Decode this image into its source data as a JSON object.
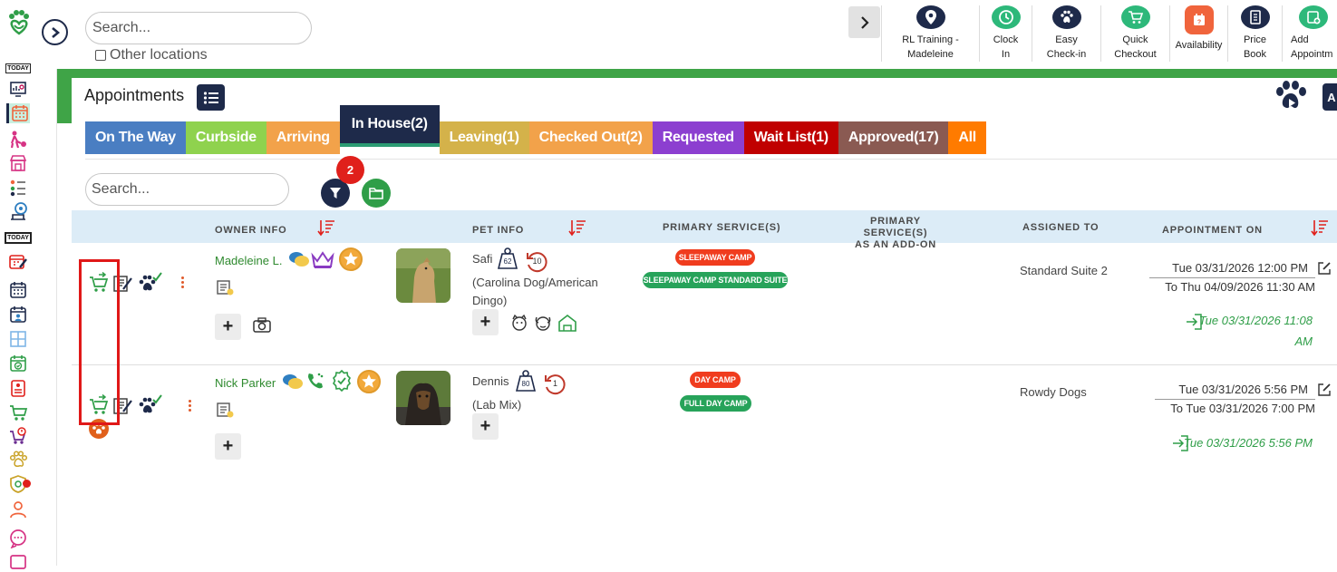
{
  "header": {
    "search_placeholder": "Search...",
    "other_locations_label": "Other locations"
  },
  "toolbar": [
    {
      "label": "RL Training -\nMadeleine",
      "icon": "location-pin-icon",
      "color": "#1e2a4a"
    },
    {
      "label": "Clock\nIn",
      "icon": "clock-icon",
      "color": "#2db87a"
    },
    {
      "label": "Easy\nCheck-in",
      "icon": "paw-icon",
      "color": "#1e2a4a"
    },
    {
      "label": "Quick\nCheckout",
      "icon": "cart-icon",
      "color": "#2db87a"
    },
    {
      "label": "Availability",
      "icon": "calendar-icon",
      "color": "#f0643c"
    },
    {
      "label": "Price\nBook",
      "icon": "book-icon",
      "color": "#1e2a4a"
    },
    {
      "label": "Add\nAppointm",
      "icon": "add-calendar-icon",
      "color": "#2db87a"
    }
  ],
  "page": {
    "title": "Appointments",
    "right_label": "A"
  },
  "tabs": [
    {
      "label": "On The Way",
      "color": "#4a7ec2"
    },
    {
      "label": "Curbside",
      "color": "#8fd24e"
    },
    {
      "label": "Arriving",
      "color": "#f2a24a"
    },
    {
      "label": "In House(2)",
      "color": "#1e2a4a",
      "active": true
    },
    {
      "label": "Leaving(1)",
      "color": "#d4b24a"
    },
    {
      "label": "Checked Out(2)",
      "color": "#f2a24a"
    },
    {
      "label": "Requested",
      "color": "#8c3fd0"
    },
    {
      "label": "Wait List(1)",
      "color": "#c00000"
    },
    {
      "label": "Approved(17)",
      "color": "#8a5a52"
    },
    {
      "label": "All",
      "color": "#ff7b00"
    }
  ],
  "grid": {
    "search_placeholder": "Search...",
    "filter_count": "2",
    "columns": {
      "owner": "OWNER INFO",
      "pet": "PET INFO",
      "primary": "PRIMARY SERVICE(S)",
      "addon_line1": "PRIMARY SERVICE(S)",
      "addon_line2": "AS AN ADD-ON",
      "assigned": "ASSIGNED TO",
      "appt_on": "APPOINTMENT ON"
    }
  },
  "rows": [
    {
      "owner": "Madeleine L.",
      "pet_name": "Safi",
      "weight": "62",
      "age": "10",
      "breed_line1": "(Carolina Dog/American",
      "breed_line2": "Dingo)",
      "services": [
        {
          "label": "SLEEPAWAY CAMP",
          "color": "#f03c1e"
        },
        {
          "label": "SLEEPAWAY CAMP STANDARD SUITE",
          "color": "#27a35a"
        }
      ],
      "assigned": "Standard Suite 2",
      "start": "Tue 03/31/2026 12:00 PM",
      "end": "To Thu 04/09/2026 11:30 AM",
      "checkin_line1": "Tue 03/31/2026 11:08",
      "checkin_line2": "AM"
    },
    {
      "owner": "Nick Parker",
      "pet_name": "Dennis",
      "weight": "80",
      "age": "1",
      "breed_line1": "(Lab Mix)",
      "services": [
        {
          "label": "DAY CAMP",
          "color": "#f03c1e"
        },
        {
          "label": "FULL DAY CAMP",
          "color": "#27a35a"
        }
      ],
      "assigned": "Rowdy Dogs",
      "start": "Tue 03/31/2026 5:56 PM",
      "end": "To Tue 03/31/2026 7:00 PM",
      "checkin_line1": "Tue 03/31/2026 5:56 PM"
    }
  ]
}
